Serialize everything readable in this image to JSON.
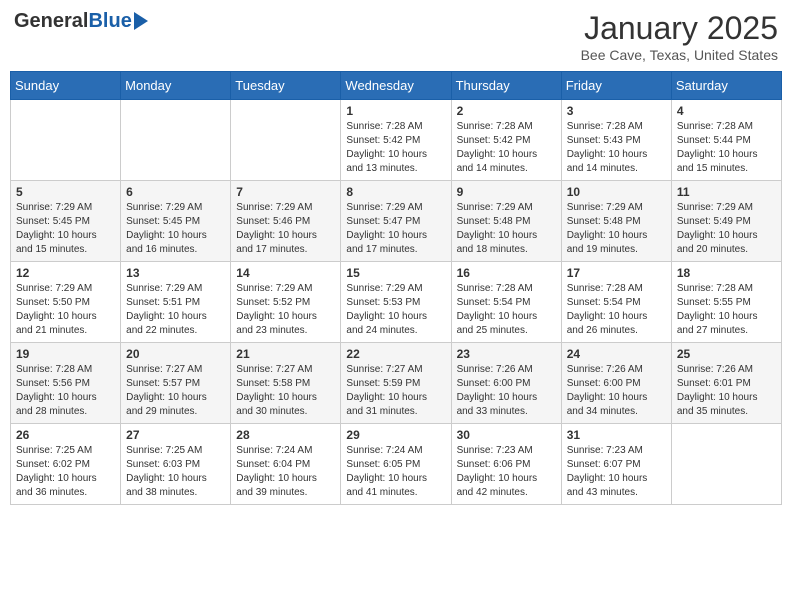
{
  "header": {
    "logo_general": "General",
    "logo_blue": "Blue",
    "month_title": "January 2025",
    "location": "Bee Cave, Texas, United States"
  },
  "days_of_week": [
    "Sunday",
    "Monday",
    "Tuesday",
    "Wednesday",
    "Thursday",
    "Friday",
    "Saturday"
  ],
  "weeks": [
    [
      {
        "day": "",
        "info": ""
      },
      {
        "day": "",
        "info": ""
      },
      {
        "day": "",
        "info": ""
      },
      {
        "day": "1",
        "info": "Sunrise: 7:28 AM\nSunset: 5:42 PM\nDaylight: 10 hours\nand 13 minutes."
      },
      {
        "day": "2",
        "info": "Sunrise: 7:28 AM\nSunset: 5:42 PM\nDaylight: 10 hours\nand 14 minutes."
      },
      {
        "day": "3",
        "info": "Sunrise: 7:28 AM\nSunset: 5:43 PM\nDaylight: 10 hours\nand 14 minutes."
      },
      {
        "day": "4",
        "info": "Sunrise: 7:28 AM\nSunset: 5:44 PM\nDaylight: 10 hours\nand 15 minutes."
      }
    ],
    [
      {
        "day": "5",
        "info": "Sunrise: 7:29 AM\nSunset: 5:45 PM\nDaylight: 10 hours\nand 15 minutes."
      },
      {
        "day": "6",
        "info": "Sunrise: 7:29 AM\nSunset: 5:45 PM\nDaylight: 10 hours\nand 16 minutes."
      },
      {
        "day": "7",
        "info": "Sunrise: 7:29 AM\nSunset: 5:46 PM\nDaylight: 10 hours\nand 17 minutes."
      },
      {
        "day": "8",
        "info": "Sunrise: 7:29 AM\nSunset: 5:47 PM\nDaylight: 10 hours\nand 17 minutes."
      },
      {
        "day": "9",
        "info": "Sunrise: 7:29 AM\nSunset: 5:48 PM\nDaylight: 10 hours\nand 18 minutes."
      },
      {
        "day": "10",
        "info": "Sunrise: 7:29 AM\nSunset: 5:48 PM\nDaylight: 10 hours\nand 19 minutes."
      },
      {
        "day": "11",
        "info": "Sunrise: 7:29 AM\nSunset: 5:49 PM\nDaylight: 10 hours\nand 20 minutes."
      }
    ],
    [
      {
        "day": "12",
        "info": "Sunrise: 7:29 AM\nSunset: 5:50 PM\nDaylight: 10 hours\nand 21 minutes."
      },
      {
        "day": "13",
        "info": "Sunrise: 7:29 AM\nSunset: 5:51 PM\nDaylight: 10 hours\nand 22 minutes."
      },
      {
        "day": "14",
        "info": "Sunrise: 7:29 AM\nSunset: 5:52 PM\nDaylight: 10 hours\nand 23 minutes."
      },
      {
        "day": "15",
        "info": "Sunrise: 7:29 AM\nSunset: 5:53 PM\nDaylight: 10 hours\nand 24 minutes."
      },
      {
        "day": "16",
        "info": "Sunrise: 7:28 AM\nSunset: 5:54 PM\nDaylight: 10 hours\nand 25 minutes."
      },
      {
        "day": "17",
        "info": "Sunrise: 7:28 AM\nSunset: 5:54 PM\nDaylight: 10 hours\nand 26 minutes."
      },
      {
        "day": "18",
        "info": "Sunrise: 7:28 AM\nSunset: 5:55 PM\nDaylight: 10 hours\nand 27 minutes."
      }
    ],
    [
      {
        "day": "19",
        "info": "Sunrise: 7:28 AM\nSunset: 5:56 PM\nDaylight: 10 hours\nand 28 minutes."
      },
      {
        "day": "20",
        "info": "Sunrise: 7:27 AM\nSunset: 5:57 PM\nDaylight: 10 hours\nand 29 minutes."
      },
      {
        "day": "21",
        "info": "Sunrise: 7:27 AM\nSunset: 5:58 PM\nDaylight: 10 hours\nand 30 minutes."
      },
      {
        "day": "22",
        "info": "Sunrise: 7:27 AM\nSunset: 5:59 PM\nDaylight: 10 hours\nand 31 minutes."
      },
      {
        "day": "23",
        "info": "Sunrise: 7:26 AM\nSunset: 6:00 PM\nDaylight: 10 hours\nand 33 minutes."
      },
      {
        "day": "24",
        "info": "Sunrise: 7:26 AM\nSunset: 6:00 PM\nDaylight: 10 hours\nand 34 minutes."
      },
      {
        "day": "25",
        "info": "Sunrise: 7:26 AM\nSunset: 6:01 PM\nDaylight: 10 hours\nand 35 minutes."
      }
    ],
    [
      {
        "day": "26",
        "info": "Sunrise: 7:25 AM\nSunset: 6:02 PM\nDaylight: 10 hours\nand 36 minutes."
      },
      {
        "day": "27",
        "info": "Sunrise: 7:25 AM\nSunset: 6:03 PM\nDaylight: 10 hours\nand 38 minutes."
      },
      {
        "day": "28",
        "info": "Sunrise: 7:24 AM\nSunset: 6:04 PM\nDaylight: 10 hours\nand 39 minutes."
      },
      {
        "day": "29",
        "info": "Sunrise: 7:24 AM\nSunset: 6:05 PM\nDaylight: 10 hours\nand 41 minutes."
      },
      {
        "day": "30",
        "info": "Sunrise: 7:23 AM\nSunset: 6:06 PM\nDaylight: 10 hours\nand 42 minutes."
      },
      {
        "day": "31",
        "info": "Sunrise: 7:23 AM\nSunset: 6:07 PM\nDaylight: 10 hours\nand 43 minutes."
      },
      {
        "day": "",
        "info": ""
      }
    ]
  ]
}
